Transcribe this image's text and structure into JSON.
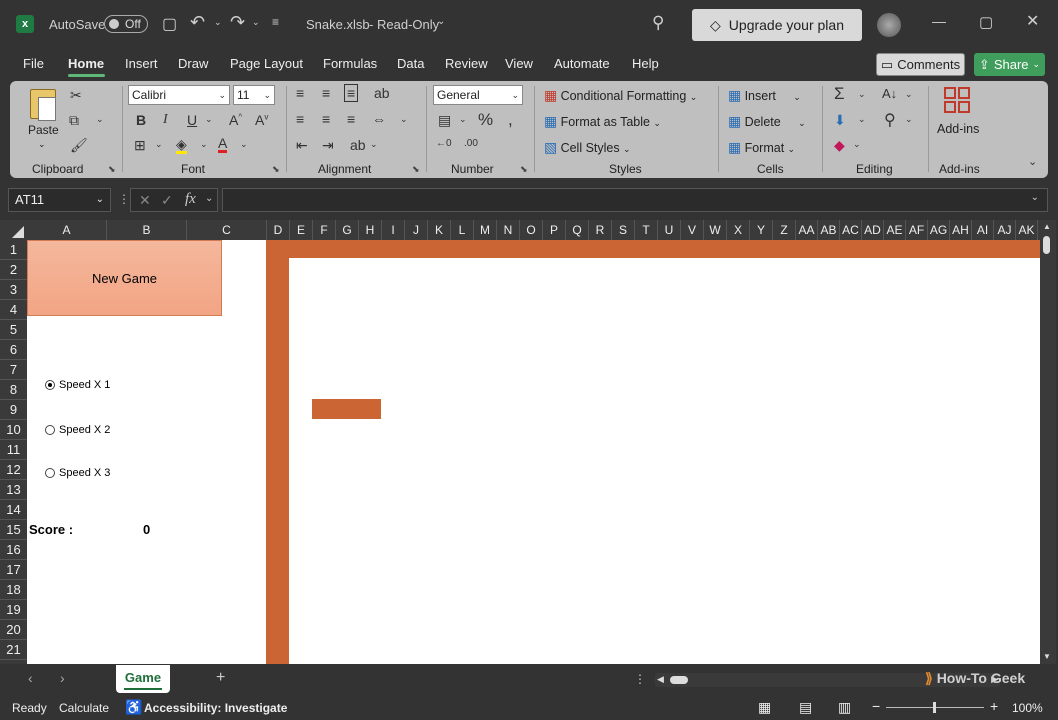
{
  "titlebar": {
    "autosave_label": "AutoSave",
    "autosave_state": "Off",
    "file_title": "Snake.xlsb",
    "mode": "Read-Only",
    "upgrade_label": "Upgrade your plan"
  },
  "menu": {
    "items": [
      "File",
      "Home",
      "Insert",
      "Draw",
      "Page Layout",
      "Formulas",
      "Data",
      "Review",
      "View",
      "Automate",
      "Help"
    ],
    "comments_label": "Comments",
    "share_label": "Share"
  },
  "ribbon": {
    "clipboard": {
      "paste_label": "Paste",
      "group_label": "Clipboard"
    },
    "font": {
      "name": "Calibri",
      "size": "11",
      "group_label": "Font",
      "bold": "B",
      "italic": "I",
      "underline": "U"
    },
    "alignment": {
      "group_label": "Alignment"
    },
    "number": {
      "format": "General",
      "group_label": "Number"
    },
    "styles": {
      "conditional": "Conditional Formatting",
      "table": "Format as Table",
      "cell_styles": "Cell Styles",
      "group_label": "Styles"
    },
    "cells": {
      "insert": "Insert",
      "delete": "Delete",
      "format": "Format",
      "group_label": "Cells"
    },
    "editing": {
      "group_label": "Editing"
    },
    "addins": {
      "label": "Add-ins",
      "group_label": "Add-ins"
    }
  },
  "formula_bar": {
    "namebox": "AT11",
    "fx": "fx"
  },
  "grid": {
    "columns": [
      "A",
      "B",
      "C",
      "D",
      "E",
      "F",
      "G",
      "H",
      "I",
      "J",
      "K",
      "L",
      "M",
      "N",
      "O",
      "P",
      "Q",
      "R",
      "S",
      "T",
      "U",
      "V",
      "W",
      "X",
      "Y",
      "Z",
      "AA",
      "AB",
      "AC",
      "AD",
      "AE",
      "AF",
      "AG",
      "AH",
      "AI",
      "AJ",
      "AK"
    ],
    "rows": [
      "1",
      "2",
      "3",
      "4",
      "5",
      "6",
      "7",
      "8",
      "9",
      "10",
      "11",
      "12",
      "13",
      "14",
      "15",
      "16",
      "17",
      "18",
      "19",
      "20",
      "21"
    ]
  },
  "game": {
    "new_game_label": "New Game",
    "speed_options": [
      {
        "label": "Speed X 1",
        "selected": true
      },
      {
        "label": "Speed X 2",
        "selected": false
      },
      {
        "label": "Speed X 3",
        "selected": false
      }
    ],
    "score_label": "Score :",
    "score_value": "0",
    "wall_color": "#cb6534"
  },
  "sheets": {
    "active": "Game"
  },
  "watermark": "How-To Geek",
  "status": {
    "ready": "Ready",
    "calculate": "Calculate",
    "accessibility": "Accessibility: Investigate",
    "zoom": "100%"
  }
}
